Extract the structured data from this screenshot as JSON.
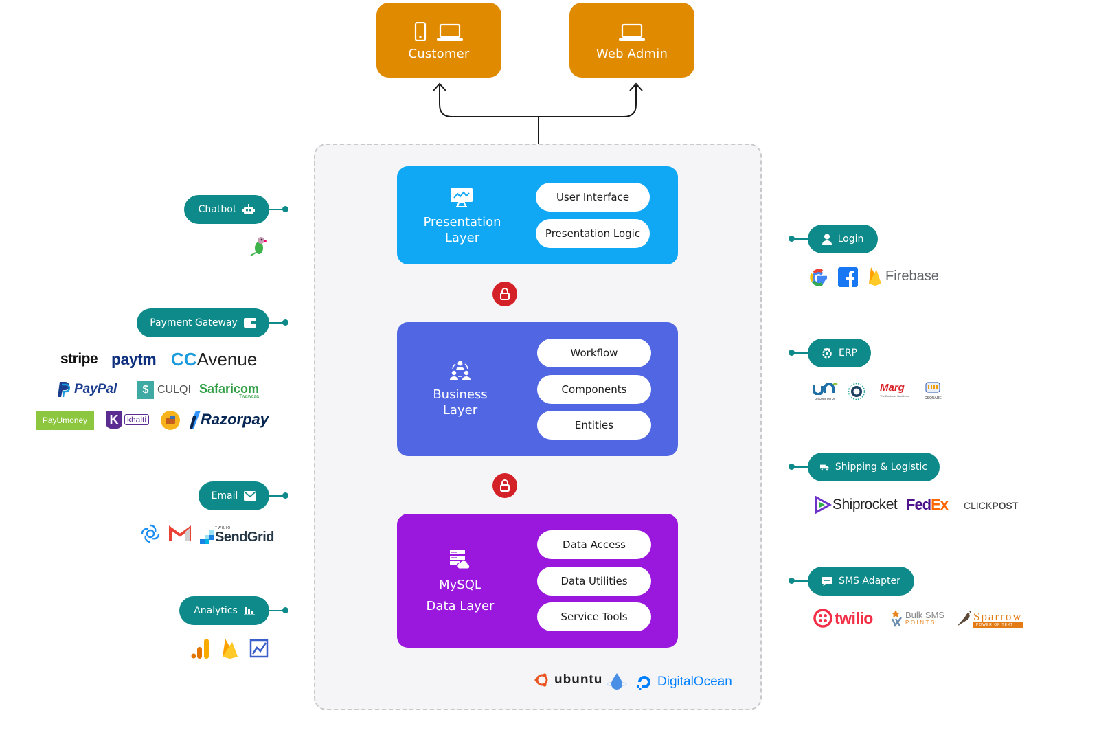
{
  "clients": {
    "customer": {
      "label": "Customer",
      "icons": [
        "mobile-icon",
        "laptop-icon"
      ]
    },
    "web_admin": {
      "label": "Web Admin",
      "icons": [
        "laptop-icon"
      ]
    }
  },
  "layers": {
    "presentation": {
      "title_line1": "Presentation",
      "title_line2": "Layer",
      "icon": "presentation-chart-icon",
      "color": "#10a8f5",
      "components": [
        "User Interface",
        "Presentation Logic"
      ]
    },
    "business": {
      "title_line1": "Business",
      "title_line2": "Layer",
      "icon": "team-network-icon",
      "color": "#5066e3",
      "components": [
        "Workflow",
        "Components",
        "Entities"
      ]
    },
    "data": {
      "title_line1": "MySQL",
      "title_line2": "Data Layer",
      "icon": "server-cloud-icon",
      "color": "#9a17dd",
      "components": [
        "Data Access",
        "Data Utilities",
        "Service Tools"
      ]
    }
  },
  "hosting": [
    "ubuntu",
    "DigitalOcean"
  ],
  "left_services": [
    {
      "label": "Chatbot",
      "icon": "robot-icon",
      "providers": [
        "Tawk.to"
      ]
    },
    {
      "label": "Payment Gateway",
      "icon": "wallet-icon",
      "providers": [
        "stripe",
        "paytm",
        "CCAvenue",
        "PayPal",
        "CULQI",
        "Safaricom",
        "PayUmoney",
        "khalti",
        "Wallet",
        "Razorpay"
      ]
    },
    {
      "label": "Email",
      "icon": "envelope-icon",
      "providers": [
        "Sendinblue",
        "Gmail",
        "SendGrid"
      ]
    },
    {
      "label": "Analytics",
      "icon": "bar-chart-icon",
      "providers": [
        "Google Analytics",
        "Firebase",
        "Trend"
      ]
    }
  ],
  "right_services": [
    {
      "label": "Login",
      "icon": "user-icon",
      "providers": [
        "Google",
        "Facebook",
        "Firebase"
      ]
    },
    {
      "label": "ERP",
      "icon": "erp-gear-icon",
      "providers": [
        "unicommerce",
        "ERP Seal",
        "Marg",
        "CSQUARE"
      ]
    },
    {
      "label": "Shipping & Logistic",
      "icon": "truck-icon",
      "providers": [
        "Shiprocket",
        "FedEx",
        "CLICKPOST"
      ]
    },
    {
      "label": "SMS Adapter",
      "icon": "chat-bubble-icon",
      "providers": [
        "twilio",
        "Bulk SMS Points",
        "Sparrow"
      ]
    }
  ],
  "logo_text": {
    "stripe": "stripe",
    "paytm": "paytm",
    "cc": "CC",
    "avenue": "Avenue",
    "paypal": "PayPal",
    "culqi": "CULQI",
    "safaricom": "Safaricom",
    "twaweza": "Twaweza",
    "payu": "PayUmoney",
    "khalti": "khalti",
    "razorpay": "Razorpay",
    "twilio_small": "TWILIO",
    "sendgrid": "SendGrid",
    "firebase": "Firebase",
    "unicommerce": "unicommerce",
    "marg": "Marg",
    "marg_sub": "The Business Backbone",
    "csquare": "CSQUARE",
    "shiprocket": "Shiprocket",
    "fed": "Fed",
    "ex": "Ex",
    "clickpost_a": "CLICK",
    "clickpost_b": "POST",
    "twilio": "twilio",
    "bulk_sms": "Bulk SMS",
    "points": "POINTS",
    "sparrow": "Sparrow",
    "sparrow_sub": "POWER OF TEXT",
    "ubuntu": "ubuntu",
    "digitalocean": "DigitalOcean"
  }
}
